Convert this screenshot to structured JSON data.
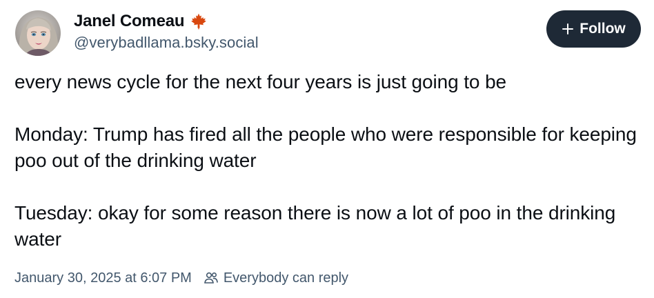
{
  "author": {
    "display_name": "Janel Comeau",
    "handle": "@verybadllama.bsky.social",
    "name_icon": "maple-leaf-icon",
    "avatar": "avatar-photo"
  },
  "follow_button": {
    "label": "Follow",
    "icon": "plus-icon"
  },
  "post": {
    "paragraphs": [
      "every news cycle for the next four years is just going to be",
      "Monday: Trump has fired all the people who were responsible for keeping poo out of the drinking water",
      "Tuesday: okay for some reason there is now a lot of poo in the drinking water"
    ]
  },
  "meta": {
    "timestamp": "January 30, 2025 at 6:07 PM",
    "reply_setting_icon": "people-icon",
    "reply_setting": "Everybody can reply"
  },
  "colors": {
    "text": "#0b0f14",
    "secondary_text": "#42576c",
    "follow_button_bg": "#1e2936",
    "follow_button_text": "#ffffff",
    "maple_leaf": "#d9480f"
  }
}
